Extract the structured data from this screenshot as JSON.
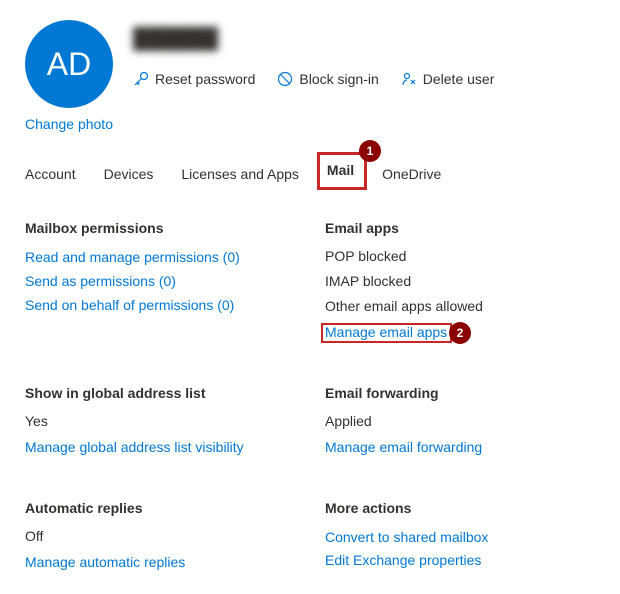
{
  "user": {
    "initials": "AD",
    "name": "██████",
    "change_photo": "Change photo"
  },
  "actions": {
    "reset_password": "Reset password",
    "block_signin": "Block sign-in",
    "delete_user": "Delete user"
  },
  "tabs": {
    "account": "Account",
    "devices": "Devices",
    "licenses": "Licenses and Apps",
    "mail": "Mail",
    "onedrive": "OneDrive"
  },
  "annotations": {
    "marker1": "1",
    "marker2": "2"
  },
  "sections": {
    "mailbox_permissions": {
      "title": "Mailbox permissions",
      "links": {
        "read_manage": "Read and manage permissions (0)",
        "send_as": "Send as permissions (0)",
        "send_on_behalf": "Send on behalf of permissions (0)"
      }
    },
    "email_apps": {
      "title": "Email apps",
      "values": {
        "pop": "POP blocked",
        "imap": "IMAP blocked",
        "other": "Other email apps allowed"
      },
      "link": "Manage email apps"
    },
    "gal": {
      "title": "Show in global address list",
      "value": "Yes",
      "link": "Manage global address list visibility"
    },
    "forwarding": {
      "title": "Email forwarding",
      "value": "Applied",
      "link": "Manage email forwarding"
    },
    "auto_replies": {
      "title": "Automatic replies",
      "value": "Off",
      "link": "Manage automatic replies"
    },
    "more_actions": {
      "title": "More actions",
      "links": {
        "convert": "Convert to shared mailbox",
        "exchange": "Edit Exchange properties"
      }
    }
  }
}
